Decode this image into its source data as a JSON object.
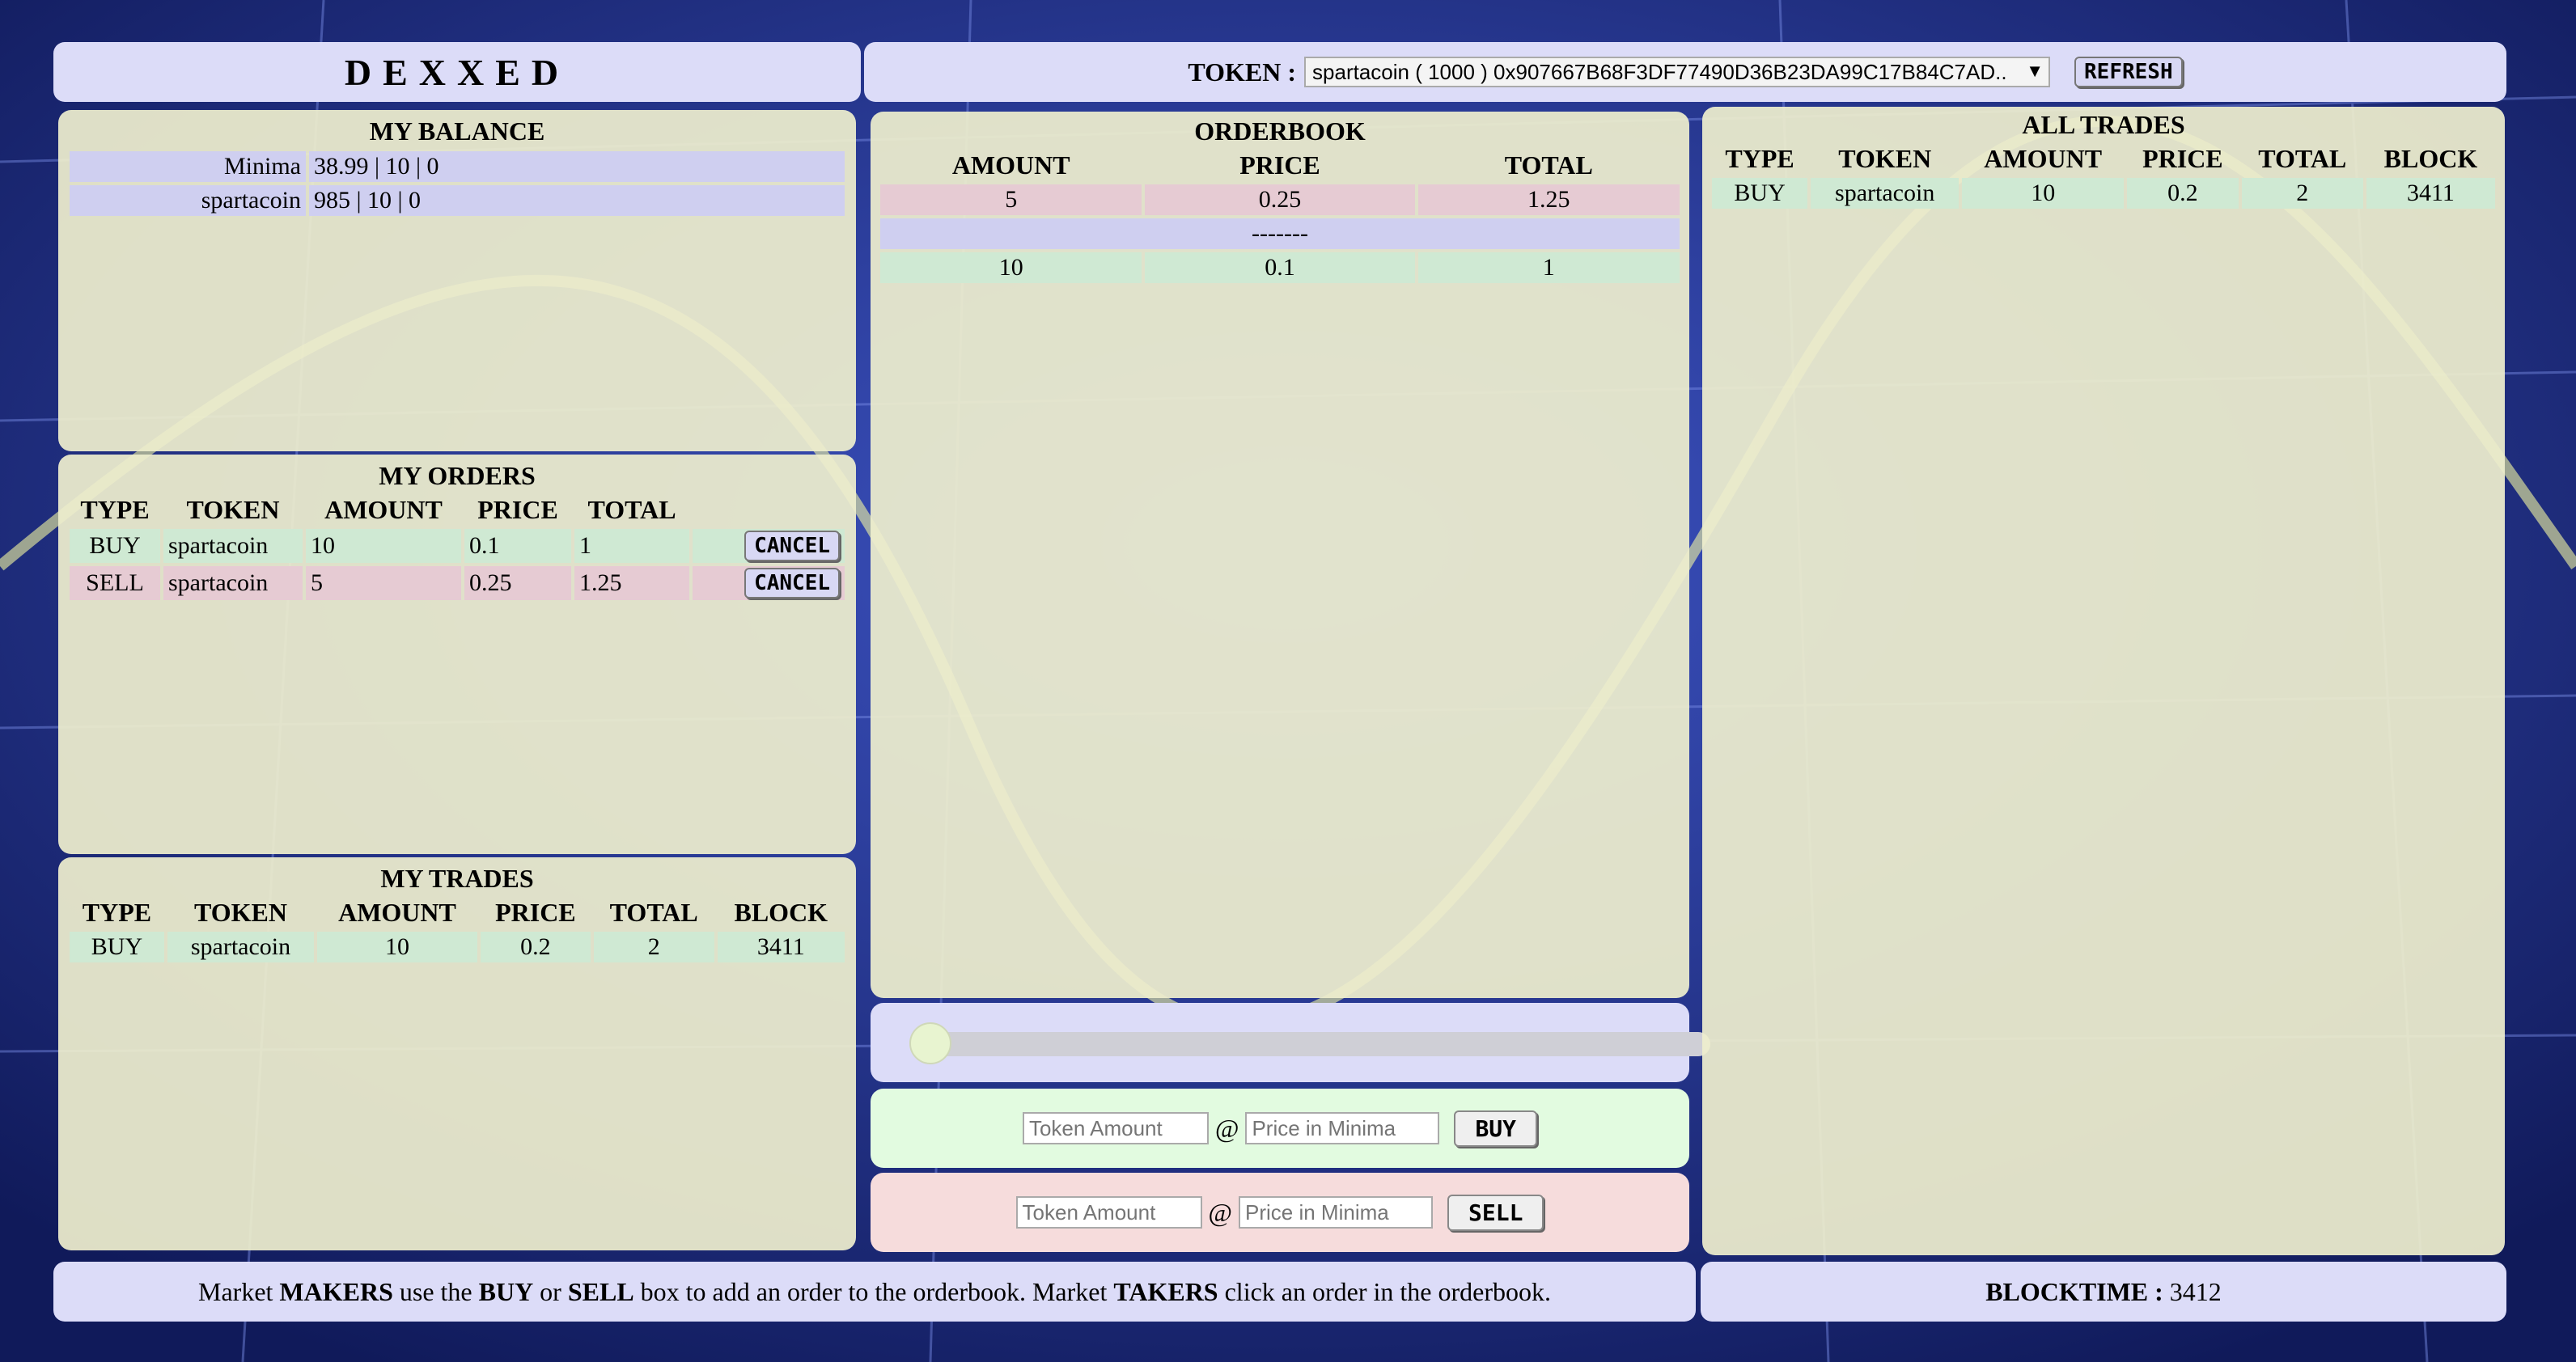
{
  "header": {
    "app_title": "DEXXED",
    "token_label": "TOKEN :",
    "token_selected": "spartacoin ( 1000 ) 0x907667B68F3DF77490D36B23DA99C17B84C7AD..",
    "refresh_label": "REFRESH"
  },
  "balance": {
    "title": "MY BALANCE",
    "rows": [
      {
        "token": "Minima",
        "value": "38.99 | 10 | 0"
      },
      {
        "token": "spartacoin",
        "value": "985 | 10 | 0"
      }
    ]
  },
  "my_orders": {
    "title": "MY ORDERS",
    "headers": [
      "TYPE",
      "TOKEN",
      "AMOUNT",
      "PRICE",
      "TOTAL"
    ],
    "rows": [
      {
        "type": "BUY",
        "token": "spartacoin",
        "amount": "10",
        "price": "0.1",
        "total": "1",
        "action": "CANCEL"
      },
      {
        "type": "SELL",
        "token": "spartacoin",
        "amount": "5",
        "price": "0.25",
        "total": "1.25",
        "action": "CANCEL"
      }
    ]
  },
  "my_trades": {
    "title": "MY TRADES",
    "headers": [
      "TYPE",
      "TOKEN",
      "AMOUNT",
      "PRICE",
      "TOTAL",
      "BLOCK"
    ],
    "rows": [
      {
        "type": "BUY",
        "token": "spartacoin",
        "amount": "10",
        "price": "0.2",
        "total": "2",
        "block": "3411"
      }
    ]
  },
  "orderbook": {
    "title": "ORDERBOOK",
    "headers": [
      "AMOUNT",
      "PRICE",
      "TOTAL"
    ],
    "sell_rows": [
      {
        "amount": "5",
        "price": "0.25",
        "total": "1.25"
      }
    ],
    "separator": "-------",
    "buy_rows": [
      {
        "amount": "10",
        "price": "0.1",
        "total": "1"
      }
    ]
  },
  "slider": {
    "value": 0
  },
  "buy_form": {
    "amount_placeholder": "Token Amount",
    "at": "@",
    "price_placeholder": "Price in Minima",
    "button": "BUY"
  },
  "sell_form": {
    "amount_placeholder": "Token Amount",
    "at": "@",
    "price_placeholder": "Price in Minima",
    "button": "SELL"
  },
  "all_trades": {
    "title": "ALL TRADES",
    "headers": [
      "TYPE",
      "TOKEN",
      "AMOUNT",
      "PRICE",
      "TOTAL",
      "BLOCK"
    ],
    "rows": [
      {
        "type": "BUY",
        "token": "spartacoin",
        "amount": "10",
        "price": "0.2",
        "total": "2",
        "block": "3411"
      }
    ]
  },
  "footer": {
    "t1": "Market ",
    "b1": "MAKERS",
    "t2": " use the ",
    "b2": "BUY",
    "t3": " or ",
    "b3": "SELL",
    "t4": " box to add an order to the orderbook. Market ",
    "b4": "TAKERS",
    "t5": " click an order in the orderbook.",
    "blocktime_label": "BLOCKTIME :",
    "blocktime_value": " 3412"
  },
  "colors": {
    "background": "#1c2a78",
    "panel_lavender": "#dcdcf8",
    "panel_beige": "#eeeece",
    "buy_green": "#cfe9d3",
    "sell_pink": "#e6cbd3"
  }
}
